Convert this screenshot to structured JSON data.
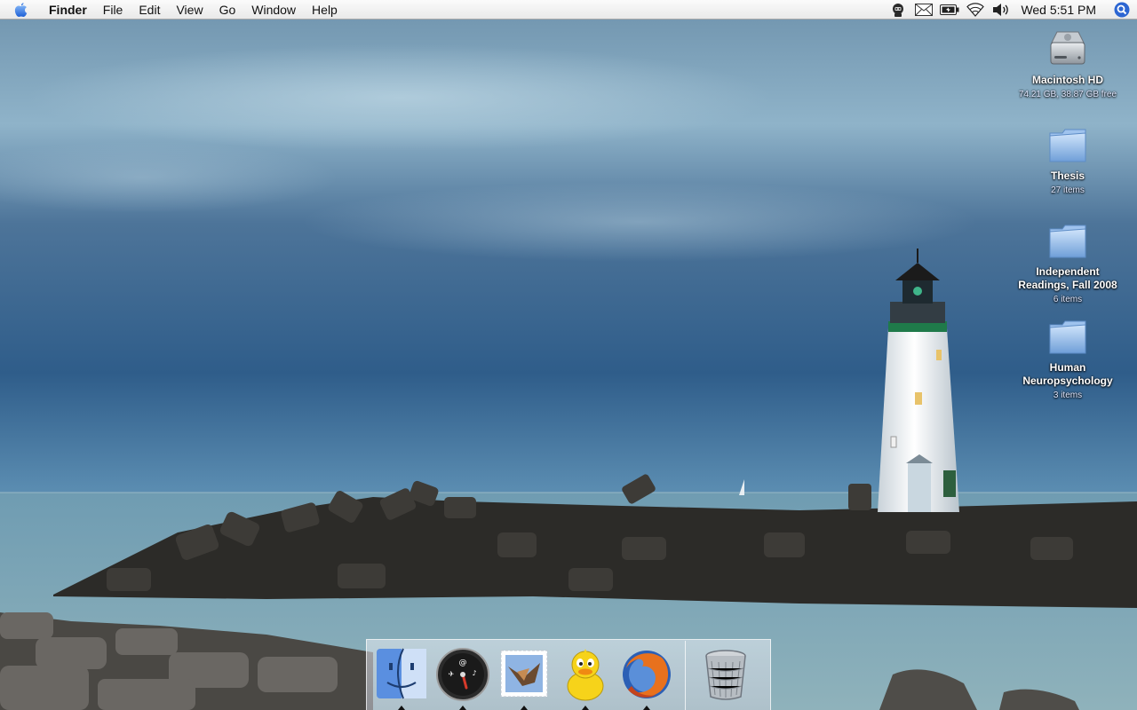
{
  "menubar": {
    "apple_icon": "apple-icon",
    "app_name": "Finder",
    "items": [
      "File",
      "Edit",
      "View",
      "Go",
      "Window",
      "Help"
    ],
    "status_icons": [
      "robot-icon",
      "mail-icon",
      "battery-icon",
      "wifi-icon",
      "volume-icon"
    ],
    "clock": "Wed 5:51 PM",
    "spotlight_icon": "spotlight-search-icon"
  },
  "desktop": {
    "icons": [
      {
        "name": "Macintosh HD",
        "info": "74.21 GB, 38.87 GB free",
        "icon": "hard-drive-icon"
      },
      {
        "name": "Thesis",
        "info": "27 items",
        "icon": "folder-icon"
      },
      {
        "name": "Independent Readings, Fall 2008",
        "info": "6 items",
        "icon": "folder-icon"
      },
      {
        "name": "Human Neuropsychology",
        "info": "3 items",
        "icon": "folder-icon"
      }
    ]
  },
  "dock": {
    "apps": [
      {
        "icon": "finder-icon",
        "running": true
      },
      {
        "icon": "dashboard-icon",
        "running": true
      },
      {
        "icon": "mail-stamp-icon",
        "running": true
      },
      {
        "icon": "adium-duck-icon",
        "running": true
      },
      {
        "icon": "firefox-icon",
        "running": true
      }
    ],
    "trash_icon": "trash-icon"
  },
  "colors": {
    "sky_top": "#7a9cb4",
    "sky_bottom": "#2a5580",
    "sea": "#86a8b5",
    "rocks": "#2b2a27",
    "folder_blue": "#8fb8e8",
    "lighthouse_band": "#1f7a4a"
  }
}
